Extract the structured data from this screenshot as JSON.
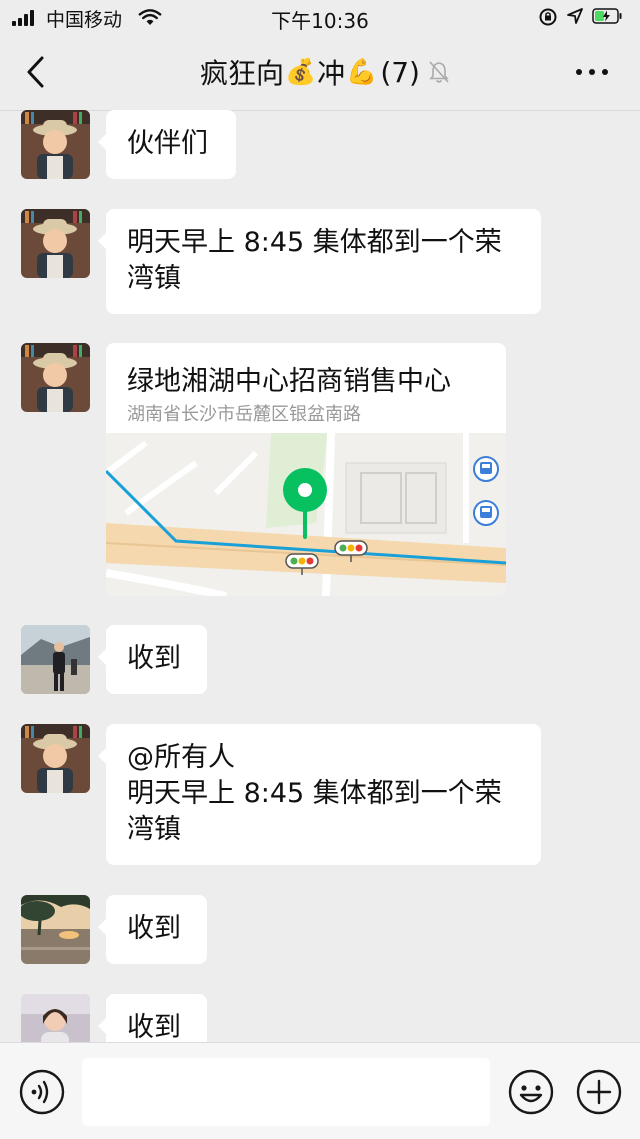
{
  "status_bar": {
    "carrier": "中国移动",
    "time": "下午10:36"
  },
  "nav": {
    "title_prefix": "疯狂向",
    "title_emoji_1": "💰",
    "title_middle": "冲",
    "title_emoji_2": "💪",
    "member_count": "(7)"
  },
  "messages": [
    {
      "sender_avatar": "child-with-hat",
      "lines": [
        "伙伴们"
      ]
    },
    {
      "sender_avatar": "child-with-hat",
      "lines": [
        "明天早上 8:45 集体都到一个荣",
        "湾镇"
      ]
    },
    {
      "sender_avatar": "child-with-hat",
      "type": "location",
      "place_name": "绿地湘湖中心招商销售中心",
      "address": "湖南省长沙市岳麓区银盆南路"
    },
    {
      "sender_avatar": "man-outdoors",
      "lines": [
        "收到"
      ]
    },
    {
      "sender_avatar": "child-with-hat",
      "lines": [
        "@所有人",
        "明天早上 8:45 集体都到一个荣",
        "湾镇"
      ]
    },
    {
      "sender_avatar": "sunset-tree",
      "lines": [
        "收到"
      ]
    },
    {
      "sender_avatar": "girl-photo",
      "lines": [
        "收到"
      ]
    }
  ],
  "input_bar": {
    "placeholder": ""
  },
  "colors": {
    "background": "#ededed",
    "bubble": "#ffffff",
    "map_pin": "#07c160",
    "route": "#1aa0d8"
  }
}
